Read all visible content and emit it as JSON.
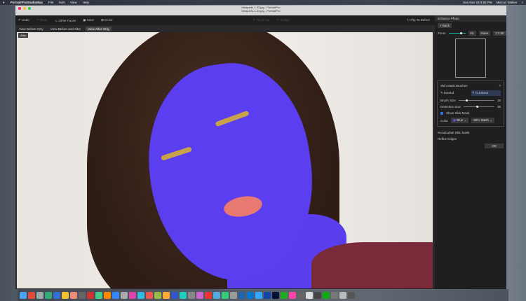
{
  "menubar": {
    "app": "PortraitProStudioMax",
    "items": [
      "File",
      "Edit",
      "View",
      "Help"
    ],
    "clock": "Sun Nov 18  9:56 PM",
    "user": "Marcus Walker"
  },
  "window": {
    "title1": "bleaparts-1-03.jpg - PortraitPro",
    "title2": "bleaparts-1-03.jpg - PortraitPro"
  },
  "toolbar": {
    "undo": "Undo",
    "redo": "Redo",
    "other_faces": "Other Faces",
    "save": "Save",
    "close": "Close",
    "touch_up": "Touch Up",
    "sculpt": "Sculpt",
    "flip": "Flip To Before"
  },
  "view_tabs": [
    "View Before Only",
    "View Before and After",
    "View After Only"
  ],
  "canvas": {
    "badge": "After"
  },
  "panel": {
    "title": "Enhance Photo",
    "back": "< Back",
    "zoom_label": "Zoom",
    "zoom_level": 0.7,
    "fit": "Fit",
    "pane": "Pane",
    "ratio": "1:3.06",
    "skin": {
      "title": "Skin Mask Brushes",
      "help": "?",
      "extend": "Extend",
      "cut_back": "Cut Back",
      "brush_size_label": "Brush Size",
      "brush_size": "15",
      "brush_level": 0.2,
      "detection_label": "Detection Size",
      "detection": "35",
      "detection_level": 0.4,
      "show_mask": "Show Skin Mask",
      "color_label": "Color",
      "color": "Blue",
      "wash": "50% Wash",
      "recalc": "Recalculate Skin Mask",
      "refine": "Refine Edges",
      "ok": "OK"
    }
  },
  "colors": {
    "mask": "#5b3ef0",
    "accent": "#2f6fd6"
  },
  "dock": {
    "icons": [
      "#4aa3f0",
      "#e04b3c",
      "#9aa",
      "#3a7",
      "#2f6fd6",
      "#f2c230",
      "#e87",
      "#666",
      "#c33",
      "#4c8",
      "#f80",
      "#38f",
      "#aaa",
      "#d4a",
      "#3bd",
      "#e55",
      "#9b4",
      "#fa3",
      "#35c",
      "#2cb",
      "#888",
      "#c6c",
      "#e33",
      "#5ad",
      "#3c7",
      "#999",
      "#26a",
      "#07c",
      "#3af",
      "#14a",
      "#013",
      "#2a2",
      "#f4a",
      "#666",
      "#ddd",
      "#444",
      "#1a1",
      "#777",
      "#bbb",
      "#555"
    ]
  }
}
